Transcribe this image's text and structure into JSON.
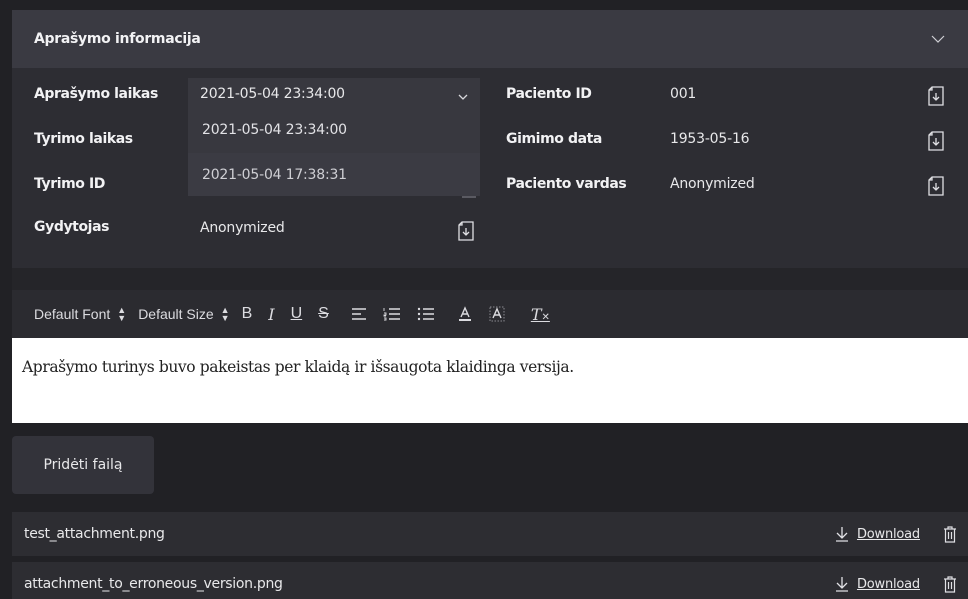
{
  "panel": {
    "title": "Aprašymo informacija",
    "left_rows": [
      {
        "label": "Aprašymo laikas"
      },
      {
        "label": "Tyrimo laikas"
      },
      {
        "label": "Tyrimo ID"
      },
      {
        "label": "Gydytojas",
        "value": "Anonymized"
      }
    ],
    "select": {
      "value": "2021-05-04 23:34:00",
      "options": [
        "2021-05-04 23:34:00",
        "2021-05-04 17:38:31"
      ]
    },
    "right_rows": [
      {
        "label": "Paciento ID",
        "value": "001"
      },
      {
        "label": "Gimimo data",
        "value": "1953-05-16"
      },
      {
        "label": "Paciento vardas",
        "value": "Anonymized"
      }
    ]
  },
  "toolbar": {
    "font": "Default Font",
    "size": "Default Size",
    "bold": "B",
    "italic": "I",
    "underline": "U",
    "strike": "S",
    "clear": "T"
  },
  "editor": {
    "content": "Aprašymo turinys buvo pakeistas per klaidą ir išsaugota klaidinga versija."
  },
  "add_file_label": "Pridėti failą",
  "files": [
    {
      "name": "test_attachment.png",
      "download": "Download"
    },
    {
      "name": "attachment_to_erroneous_version.png",
      "download": "Download"
    }
  ]
}
